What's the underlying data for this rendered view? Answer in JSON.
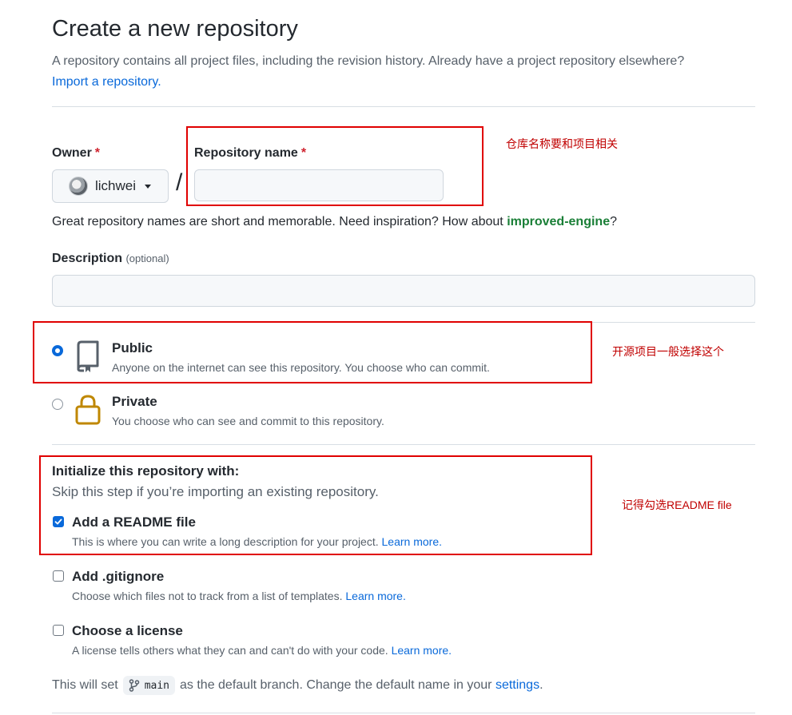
{
  "header": {
    "title": "Create a new repository",
    "subtitle": "A repository contains all project files, including the revision history. Already have a project repository elsewhere?",
    "import_link": "Import a repository."
  },
  "owner": {
    "label": "Owner",
    "required_mark": "*",
    "selected": "lichwei",
    "separator": "/"
  },
  "repo_name": {
    "label": "Repository name",
    "required_mark": "*",
    "value": "",
    "placeholder": ""
  },
  "name_hint": {
    "text": "Great repository names are short and memorable. Need inspiration? How about ",
    "suggestion": "improved-engine",
    "tail": "?"
  },
  "description": {
    "label": "Description",
    "optional": "(optional)",
    "value": ""
  },
  "visibility": {
    "public": {
      "title": "Public",
      "desc": "Anyone on the internet can see this repository. You choose who can commit.",
      "checked": true
    },
    "private": {
      "title": "Private",
      "desc": "You choose who can see and commit to this repository.",
      "checked": false
    }
  },
  "init": {
    "title": "Initialize this repository with:",
    "subtitle": "Skip this step if you’re importing an existing repository.",
    "readme": {
      "title": "Add a README file",
      "desc": "This is where you can write a long description for your project.",
      "link": "Learn more.",
      "checked": true
    },
    "gitignore": {
      "title": "Add .gitignore",
      "desc": "Choose which files not to track from a list of templates.",
      "link": "Learn more.",
      "checked": false
    },
    "license": {
      "title": "Choose a license",
      "desc": "A license tells others what they can and can't do with your code.",
      "link": "Learn more.",
      "checked": false
    }
  },
  "footer": {
    "prefix": "This will set",
    "branch": "main",
    "middle": "as the default branch. Change the default name in your",
    "settings_link": "settings",
    "suffix": "."
  },
  "annotations": {
    "repo_name_note": "仓库名称要和项目相关",
    "public_note": "开源项目一般选择这个",
    "readme_note": "记得勾选README file"
  },
  "colors": {
    "accent_blue": "#0969da",
    "annotation_red": "#e00000",
    "suggestion_green": "#1a7f37"
  }
}
